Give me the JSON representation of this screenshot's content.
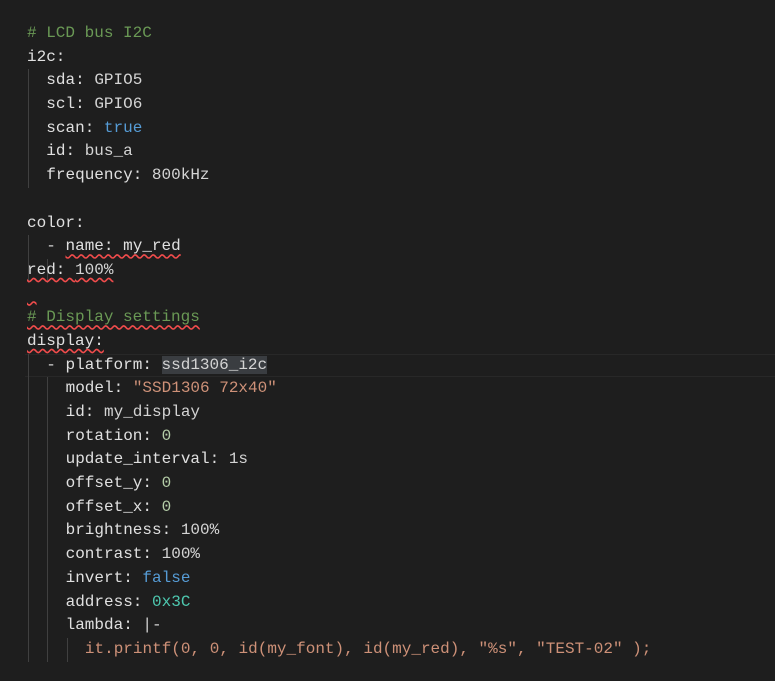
{
  "editor": {
    "language": "yaml",
    "lines": [
      {
        "indent": 0,
        "guides": 0,
        "tokens": [
          {
            "t": "# LCD bus I2C",
            "c": "comment"
          }
        ]
      },
      {
        "indent": 0,
        "guides": 0,
        "tokens": [
          {
            "t": "i2c:",
            "c": "key"
          }
        ]
      },
      {
        "indent": 2,
        "guides": 1,
        "tokens": [
          {
            "t": "sda: ",
            "c": "key"
          },
          {
            "t": "GPIO5",
            "c": "plain"
          }
        ]
      },
      {
        "indent": 2,
        "guides": 1,
        "tokens": [
          {
            "t": "scl: ",
            "c": "key"
          },
          {
            "t": "GPIO6",
            "c": "plain"
          }
        ]
      },
      {
        "indent": 2,
        "guides": 1,
        "tokens": [
          {
            "t": "scan: ",
            "c": "key"
          },
          {
            "t": "true",
            "c": "bool"
          }
        ]
      },
      {
        "indent": 2,
        "guides": 1,
        "tokens": [
          {
            "t": "id: ",
            "c": "key"
          },
          {
            "t": "bus_a",
            "c": "plain"
          }
        ]
      },
      {
        "indent": 2,
        "guides": 1,
        "tokens": [
          {
            "t": "frequency: ",
            "c": "key"
          },
          {
            "t": "800kHz",
            "c": "plain"
          }
        ]
      },
      {
        "indent": 0,
        "guides": 0,
        "tokens": []
      },
      {
        "indent": 0,
        "guides": 0,
        "tokens": [
          {
            "t": "color:",
            "c": "key"
          }
        ]
      },
      {
        "indent": 2,
        "guides": 1,
        "tokens": [
          {
            "t": "- ",
            "c": "plain"
          },
          {
            "t": "name: my_red",
            "c": "key",
            "squiggle": true
          }
        ]
      },
      {
        "indent": 4,
        "guides": 2,
        "squiggleLine": true,
        "tokens": [
          {
            "t": "red: ",
            "c": "key"
          },
          {
            "t": "100%",
            "c": "plain"
          }
        ]
      },
      {
        "indent": 0,
        "guides": 0,
        "tokens": [
          {
            "t": " ",
            "c": "plain",
            "squiggle": true
          }
        ]
      },
      {
        "indent": 0,
        "guides": 0,
        "tokens": [
          {
            "t": "# Display settings",
            "c": "comment",
            "squiggle": true
          }
        ]
      },
      {
        "indent": 0,
        "guides": 0,
        "tokens": [
          {
            "t": "display:",
            "c": "key",
            "squiggle": true
          }
        ]
      },
      {
        "indent": 2,
        "guides": 1,
        "current": true,
        "tokens": [
          {
            "t": "- ",
            "c": "plain"
          },
          {
            "t": "platform: ",
            "c": "key"
          },
          {
            "t": "ssd1306_i2c",
            "c": "plain",
            "selected": true
          }
        ]
      },
      {
        "indent": 4,
        "guides": 2,
        "tokens": [
          {
            "t": "model: ",
            "c": "key"
          },
          {
            "t": "\"SSD1306 72x40\"",
            "c": "str"
          }
        ]
      },
      {
        "indent": 4,
        "guides": 2,
        "tokens": [
          {
            "t": "id: ",
            "c": "key"
          },
          {
            "t": "my_display",
            "c": "plain"
          }
        ]
      },
      {
        "indent": 4,
        "guides": 2,
        "tokens": [
          {
            "t": "rotation: ",
            "c": "key"
          },
          {
            "t": "0",
            "c": "num"
          }
        ]
      },
      {
        "indent": 4,
        "guides": 2,
        "tokens": [
          {
            "t": "update_interval: ",
            "c": "key"
          },
          {
            "t": "1s",
            "c": "plain"
          }
        ]
      },
      {
        "indent": 4,
        "guides": 2,
        "tokens": [
          {
            "t": "offset_y: ",
            "c": "key"
          },
          {
            "t": "0",
            "c": "num"
          }
        ]
      },
      {
        "indent": 4,
        "guides": 2,
        "tokens": [
          {
            "t": "offset_x: ",
            "c": "key"
          },
          {
            "t": "0",
            "c": "num"
          }
        ]
      },
      {
        "indent": 4,
        "guides": 2,
        "tokens": [
          {
            "t": "brightness: ",
            "c": "key"
          },
          {
            "t": "100%",
            "c": "plain"
          }
        ]
      },
      {
        "indent": 4,
        "guides": 2,
        "tokens": [
          {
            "t": "contrast: ",
            "c": "key"
          },
          {
            "t": "100%",
            "c": "plain"
          }
        ]
      },
      {
        "indent": 4,
        "guides": 2,
        "tokens": [
          {
            "t": "invert: ",
            "c": "key"
          },
          {
            "t": "false",
            "c": "bool"
          }
        ]
      },
      {
        "indent": 4,
        "guides": 2,
        "tokens": [
          {
            "t": "address: ",
            "c": "key"
          },
          {
            "t": "0x3C",
            "c": "hex"
          }
        ]
      },
      {
        "indent": 4,
        "guides": 2,
        "tokens": [
          {
            "t": "lambda: ",
            "c": "key"
          },
          {
            "t": "|-",
            "c": "plain"
          }
        ]
      },
      {
        "indent": 6,
        "guides": 3,
        "tokens": [
          {
            "t": "it.printf(0, 0, id(my_font), id(my_red), \"%s\", \"TEST-02\" );",
            "c": "str"
          }
        ]
      }
    ]
  }
}
